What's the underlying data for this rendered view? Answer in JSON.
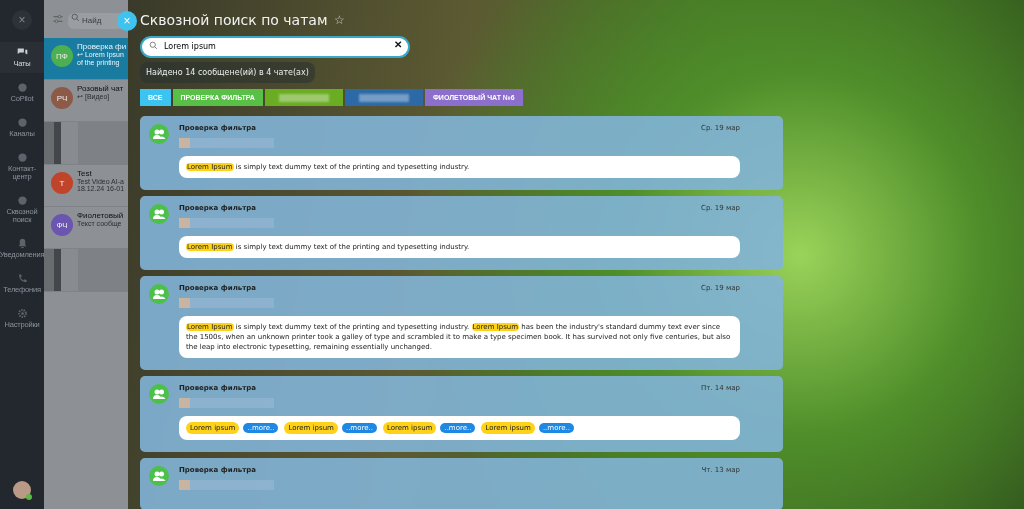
{
  "rail": {
    "close": "×",
    "items": [
      {
        "label": "Чаты",
        "selected": true
      },
      {
        "label": "CoPilot",
        "selected": false
      },
      {
        "label": "Каналы",
        "selected": false
      },
      {
        "label": "Контакт-центр",
        "selected": false
      },
      {
        "label": "Сквозной поиск",
        "selected": false
      },
      {
        "label": "Уведомления",
        "selected": false
      },
      {
        "label": "Телефония",
        "selected": false
      },
      {
        "label": "Настройки",
        "selected": false
      }
    ]
  },
  "chat_list": {
    "search": {
      "placeholder": "Найд"
    },
    "close": "×",
    "items": [
      {
        "kind": "chat",
        "initials": "ПФ",
        "color": "#4caf50",
        "name": "Проверка фи",
        "preview": "↩ Lorem Ipsun",
        "preview_2": "of the printing",
        "selected": true
      },
      {
        "kind": "chat",
        "initials": "РЧ",
        "color": "#8d5a47",
        "name": "Розовый чат",
        "preview": "↩ [Видео]",
        "selected": false
      },
      {
        "kind": "blurred"
      },
      {
        "kind": "chat",
        "initials": "Т",
        "color": "#c0442a",
        "name": "Test",
        "preview": "Test Video AI-a",
        "preview_2": "18.12.24 16-01",
        "selected": false
      },
      {
        "kind": "chat",
        "initials": "ФЧ",
        "color": "#6a55b0",
        "name": "Фиолетовый",
        "preview": "Текст сообще",
        "selected": false
      },
      {
        "kind": "blurred"
      }
    ]
  },
  "search_page": {
    "title": "Сквозной поиск по чатам",
    "star": "☆",
    "search": {
      "value": "Lorem ipsum",
      "clear": "✕"
    },
    "found": "Найдено 14 сообщене(ий) в 4 чате(ах)",
    "filters": [
      {
        "kind": "label",
        "label": "ВСЕ",
        "color": "#3cc3ef"
      },
      {
        "kind": "label",
        "label": "ПРОВЕРКА ФИЛЬТРА",
        "color": "#58c046"
      },
      {
        "kind": "blurred",
        "color": "#6aad22"
      },
      {
        "kind": "blurred",
        "color": "#2c69a6"
      },
      {
        "kind": "label",
        "label": "ФИОЛЕТОВЫЙ ЧАТ №6",
        "color": "#8c6fcd"
      }
    ],
    "results": [
      {
        "chat": "Проверка фильтра",
        "date": "Ср. 19 мар",
        "segments": [
          {
            "kind": "highlight",
            "text": "Lorem Ipsum"
          },
          {
            "kind": "text",
            "text": " is simply text dummy text of the printing and typesetting industry."
          }
        ]
      },
      {
        "chat": "Проверка фильтра",
        "date": "Ср. 19 мар",
        "segments": [
          {
            "kind": "highlight",
            "text": "Lorem Ipsum"
          },
          {
            "kind": "text",
            "text": " is simply text dummy text of the printing and typesetting industry."
          }
        ]
      },
      {
        "chat": "Проверка фильтра",
        "date": "Ср. 19 мар",
        "segments": [
          {
            "kind": "highlight",
            "text": "Lorem Ipsum"
          },
          {
            "kind": "text",
            "text": " is simply text dummy text of the printing and typesetting industry. "
          },
          {
            "kind": "highlight",
            "text": "Lorem Ipsum"
          },
          {
            "kind": "text",
            "text": " has been the industry's standard dummy text ever since the 1500s, when an unknown printer took a galley of type and scrambled it to make a type specimen book. It has survived not only five centuries, but also the leap into electronic typesetting, remaining essentially unchanged."
          }
        ]
      },
      {
        "chat": "Проверка фильтра",
        "date": "Пт. 14 мар",
        "segments": [
          {
            "kind": "chip",
            "text": "Lorem ipsum"
          },
          {
            "kind": "more",
            "text": "..more.."
          },
          {
            "kind": "chip",
            "text": "Lorem ipsum"
          },
          {
            "kind": "more",
            "text": "..more.."
          },
          {
            "kind": "chip",
            "text": "Lorem ipsum"
          },
          {
            "kind": "more",
            "text": "..more.."
          },
          {
            "kind": "chip",
            "text": "Lorem ipsum"
          },
          {
            "kind": "more",
            "text": "..more.."
          }
        ]
      },
      {
        "chat": "Проверка фильтра",
        "date": "Чт. 13 мар"
      }
    ]
  }
}
